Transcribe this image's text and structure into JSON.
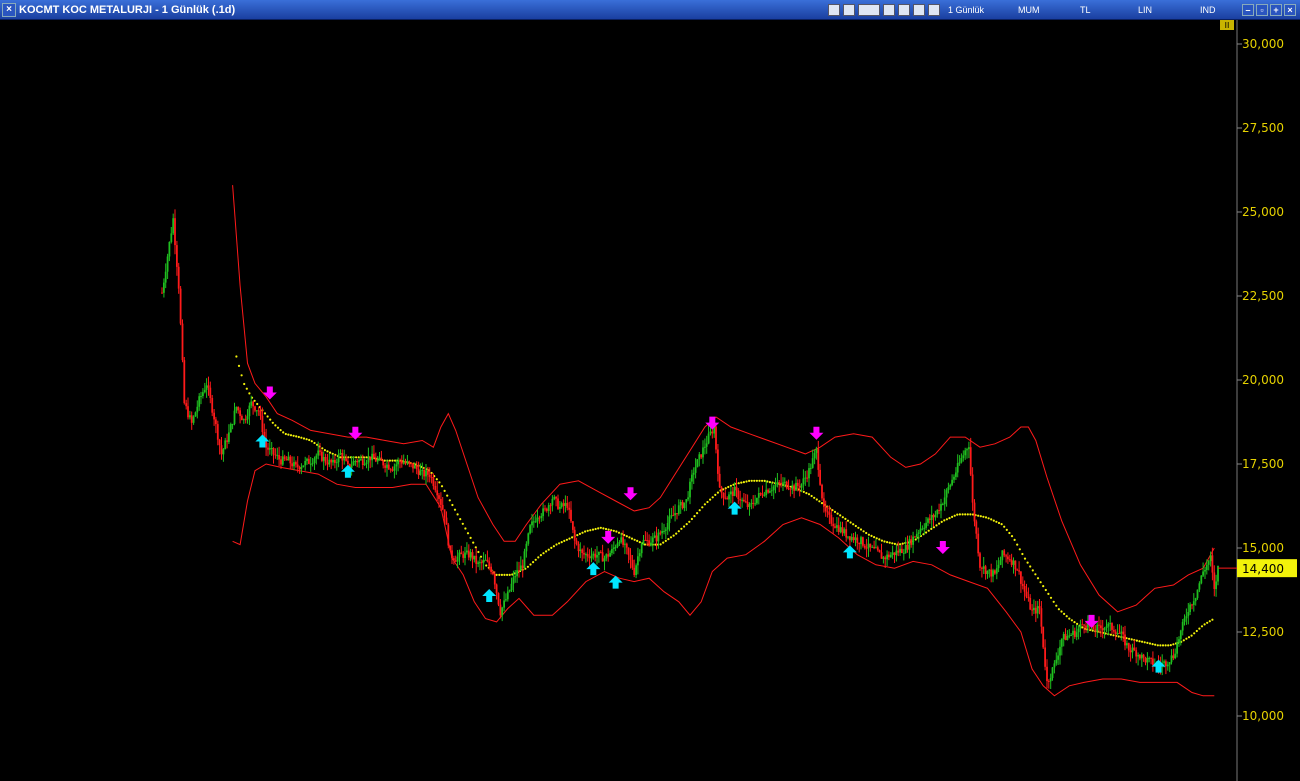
{
  "window": {
    "title": "KOCMT KOC METALURJI - 1 Günlük (.1d)",
    "close_glyph": "×",
    "toolbar_icons": [
      "chart-icon",
      "pdf-icon",
      "forward-icon",
      "compare-icon",
      "pencil-icon",
      "shapes-icon",
      "indicator-icon"
    ],
    "menu": [
      "1 Günlük",
      "MUM",
      "TL",
      "LIN",
      "IND"
    ],
    "window_controls": [
      "minimize",
      "restore",
      "maximize",
      "close"
    ]
  },
  "price_axis_badge": "II",
  "chart_data": {
    "type": "candlestick",
    "title": "",
    "ylim": [
      9000,
      31000
    ],
    "ylabel": "",
    "xlabel": "",
    "y_ticks": [
      "10,000",
      "12,500",
      "15,000",
      "17,500",
      "20,000",
      "22,500",
      "25,000",
      "27,500",
      "30,000"
    ],
    "y_tick_values": [
      10000,
      12500,
      15000,
      17500,
      20000,
      22500,
      25000,
      27500,
      30000
    ],
    "last_price_label": "14,400",
    "last_price": 14400,
    "colors": {
      "up": "#1fbf1f",
      "down": "#ff1a1a",
      "band": "#ff1a1a",
      "midline": "#f2f20a",
      "buy": "#00e5ff",
      "sell": "#ff00ff",
      "axis_text": "#e6d200"
    },
    "price_path": [
      [
        0,
        22600
      ],
      [
        6,
        24800
      ],
      [
        9,
        22800
      ],
      [
        12,
        19300
      ],
      [
        16,
        18700
      ],
      [
        20,
        19400
      ],
      [
        24,
        19900
      ],
      [
        28,
        18900
      ],
      [
        32,
        17800
      ],
      [
        36,
        18400
      ],
      [
        40,
        19200
      ],
      [
        44,
        18800
      ],
      [
        48,
        19300
      ],
      [
        52,
        19100
      ],
      [
        56,
        18000
      ],
      [
        60,
        17800
      ],
      [
        64,
        17600
      ],
      [
        68,
        17600
      ],
      [
        72,
        17400
      ],
      [
        76,
        17500
      ],
      [
        80,
        17600
      ],
      [
        84,
        17800
      ],
      [
        88,
        17600
      ],
      [
        92,
        17500
      ],
      [
        96,
        17800
      ],
      [
        100,
        17400
      ],
      [
        104,
        17600
      ],
      [
        108,
        17600
      ],
      [
        112,
        17700
      ],
      [
        116,
        17600
      ],
      [
        120,
        17500
      ],
      [
        124,
        17400
      ],
      [
        128,
        17600
      ],
      [
        132,
        17500
      ],
      [
        136,
        17400
      ],
      [
        140,
        17200
      ],
      [
        144,
        17200
      ],
      [
        148,
        16700
      ],
      [
        152,
        16000
      ],
      [
        155,
        14800
      ],
      [
        158,
        14700
      ],
      [
        162,
        14800
      ],
      [
        166,
        14800
      ],
      [
        170,
        14500
      ],
      [
        174,
        14600
      ],
      [
        178,
        14300
      ],
      [
        182,
        13100
      ],
      [
        186,
        13600
      ],
      [
        190,
        14200
      ],
      [
        194,
        14500
      ],
      [
        198,
        15600
      ],
      [
        202,
        16000
      ],
      [
        206,
        16100
      ],
      [
        210,
        16500
      ],
      [
        214,
        16200
      ],
      [
        218,
        16300
      ],
      [
        222,
        15200
      ],
      [
        226,
        14800
      ],
      [
        230,
        14800
      ],
      [
        234,
        14800
      ],
      [
        238,
        14700
      ],
      [
        242,
        14900
      ],
      [
        246,
        15300
      ],
      [
        250,
        14900
      ],
      [
        254,
        14300
      ],
      [
        258,
        15200
      ],
      [
        262,
        15200
      ],
      [
        266,
        15300
      ],
      [
        270,
        15600
      ],
      [
        274,
        15900
      ],
      [
        278,
        16200
      ],
      [
        282,
        16400
      ],
      [
        286,
        17300
      ],
      [
        290,
        17800
      ],
      [
        294,
        18300
      ],
      [
        297,
        18600
      ],
      [
        300,
        16700
      ],
      [
        304,
        16500
      ],
      [
        308,
        16700
      ],
      [
        312,
        16400
      ],
      [
        316,
        16200
      ],
      [
        320,
        16500
      ],
      [
        324,
        16700
      ],
      [
        328,
        16800
      ],
      [
        332,
        16900
      ],
      [
        336,
        16900
      ],
      [
        340,
        16800
      ],
      [
        344,
        16900
      ],
      [
        348,
        17300
      ],
      [
        352,
        17900
      ],
      [
        356,
        16100
      ],
      [
        360,
        15800
      ],
      [
        364,
        15600
      ],
      [
        368,
        15400
      ],
      [
        372,
        15300
      ],
      [
        376,
        15200
      ],
      [
        380,
        15000
      ],
      [
        384,
        14900
      ],
      [
        388,
        14700
      ],
      [
        392,
        14800
      ],
      [
        396,
        14900
      ],
      [
        400,
        15000
      ],
      [
        404,
        15300
      ],
      [
        408,
        15600
      ],
      [
        412,
        15800
      ],
      [
        416,
        16000
      ],
      [
        420,
        16400
      ],
      [
        424,
        16900
      ],
      [
        428,
        17400
      ],
      [
        432,
        17900
      ],
      [
        434,
        18100
      ],
      [
        436,
        16300
      ],
      [
        440,
        14500
      ],
      [
        444,
        14300
      ],
      [
        448,
        14200
      ],
      [
        452,
        14800
      ],
      [
        456,
        14700
      ],
      [
        460,
        14400
      ],
      [
        464,
        13700
      ],
      [
        468,
        13100
      ],
      [
        472,
        13200
      ],
      [
        476,
        11000
      ],
      [
        480,
        11500
      ],
      [
        484,
        12300
      ],
      [
        488,
        12400
      ],
      [
        492,
        12500
      ],
      [
        496,
        12800
      ],
      [
        500,
        12600
      ],
      [
        504,
        12600
      ],
      [
        508,
        12700
      ],
      [
        512,
        12600
      ],
      [
        516,
        12400
      ],
      [
        520,
        12000
      ],
      [
        524,
        11900
      ],
      [
        528,
        11700
      ],
      [
        532,
        11600
      ],
      [
        536,
        11500
      ],
      [
        540,
        11600
      ],
      [
        544,
        11800
      ],
      [
        548,
        12500
      ],
      [
        552,
        13200
      ],
      [
        556,
        13600
      ],
      [
        560,
        14300
      ],
      [
        564,
        14700
      ],
      [
        566,
        13700
      ],
      [
        568,
        14400
      ]
    ],
    "upper_band": [
      [
        38,
        25800
      ],
      [
        42,
        22800
      ],
      [
        46,
        20500
      ],
      [
        50,
        19900
      ],
      [
        56,
        19500
      ],
      [
        62,
        19000
      ],
      [
        70,
        18800
      ],
      [
        80,
        18500
      ],
      [
        90,
        18400
      ],
      [
        100,
        18300
      ],
      [
        110,
        18300
      ],
      [
        120,
        18200
      ],
      [
        130,
        18100
      ],
      [
        140,
        18200
      ],
      [
        146,
        18000
      ],
      [
        150,
        18600
      ],
      [
        154,
        19000
      ],
      [
        158,
        18500
      ],
      [
        164,
        17500
      ],
      [
        170,
        16500
      ],
      [
        178,
        15700
      ],
      [
        184,
        15200
      ],
      [
        190,
        15200
      ],
      [
        196,
        15700
      ],
      [
        204,
        16300
      ],
      [
        214,
        16900
      ],
      [
        224,
        17000
      ],
      [
        234,
        16700
      ],
      [
        244,
        16400
      ],
      [
        254,
        16100
      ],
      [
        262,
        16200
      ],
      [
        268,
        16500
      ],
      [
        276,
        17200
      ],
      [
        284,
        17900
      ],
      [
        292,
        18600
      ],
      [
        298,
        18900
      ],
      [
        306,
        18600
      ],
      [
        316,
        18400
      ],
      [
        326,
        18200
      ],
      [
        336,
        18000
      ],
      [
        346,
        17800
      ],
      [
        354,
        18000
      ],
      [
        362,
        18300
      ],
      [
        372,
        18400
      ],
      [
        382,
        18300
      ],
      [
        392,
        17700
      ],
      [
        400,
        17400
      ],
      [
        408,
        17500
      ],
      [
        416,
        17800
      ],
      [
        424,
        18300
      ],
      [
        432,
        18300
      ],
      [
        440,
        18000
      ],
      [
        448,
        18100
      ],
      [
        456,
        18300
      ],
      [
        462,
        18600
      ],
      [
        466,
        18600
      ],
      [
        470,
        18200
      ],
      [
        476,
        17100
      ],
      [
        484,
        15800
      ],
      [
        494,
        14500
      ],
      [
        504,
        13600
      ],
      [
        514,
        13100
      ],
      [
        524,
        13300
      ],
      [
        534,
        13800
      ],
      [
        544,
        13900
      ],
      [
        552,
        14200
      ],
      [
        560,
        14400
      ],
      [
        566,
        15000
      ]
    ],
    "lower_band": [
      [
        38,
        15200
      ],
      [
        42,
        15100
      ],
      [
        46,
        16400
      ],
      [
        50,
        17300
      ],
      [
        56,
        17500
      ],
      [
        64,
        17400
      ],
      [
        74,
        17300
      ],
      [
        84,
        17200
      ],
      [
        94,
        16900
      ],
      [
        104,
        16800
      ],
      [
        114,
        16800
      ],
      [
        124,
        16800
      ],
      [
        134,
        16900
      ],
      [
        142,
        16900
      ],
      [
        150,
        16200
      ],
      [
        156,
        14700
      ],
      [
        162,
        14200
      ],
      [
        168,
        13400
      ],
      [
        174,
        12900
      ],
      [
        180,
        12800
      ],
      [
        186,
        13200
      ],
      [
        192,
        13500
      ],
      [
        200,
        13000
      ],
      [
        210,
        13000
      ],
      [
        218,
        13400
      ],
      [
        228,
        14000
      ],
      [
        238,
        14300
      ],
      [
        246,
        14100
      ],
      [
        254,
        14000
      ],
      [
        262,
        14100
      ],
      [
        270,
        13700
      ],
      [
        278,
        13400
      ],
      [
        284,
        13000
      ],
      [
        290,
        13400
      ],
      [
        296,
        14300
      ],
      [
        304,
        14700
      ],
      [
        314,
        14800
      ],
      [
        324,
        15200
      ],
      [
        334,
        15700
      ],
      [
        344,
        15900
      ],
      [
        354,
        15700
      ],
      [
        364,
        15300
      ],
      [
        374,
        14800
      ],
      [
        384,
        14500
      ],
      [
        394,
        14400
      ],
      [
        404,
        14600
      ],
      [
        414,
        14500
      ],
      [
        424,
        14200
      ],
      [
        434,
        14000
      ],
      [
        444,
        13800
      ],
      [
        454,
        13100
      ],
      [
        462,
        12500
      ],
      [
        468,
        11400
      ],
      [
        474,
        10900
      ],
      [
        480,
        10600
      ],
      [
        488,
        10900
      ],
      [
        496,
        11000
      ],
      [
        506,
        11100
      ],
      [
        516,
        11100
      ],
      [
        526,
        11000
      ],
      [
        536,
        11000
      ],
      [
        546,
        11000
      ],
      [
        554,
        10700
      ],
      [
        560,
        10600
      ],
      [
        566,
        10600
      ]
    ],
    "midline": [
      [
        40,
        20700
      ],
      [
        44,
        19900
      ],
      [
        48,
        19500
      ],
      [
        54,
        19100
      ],
      [
        60,
        18700
      ],
      [
        66,
        18400
      ],
      [
        74,
        18300
      ],
      [
        80,
        18200
      ],
      [
        88,
        17900
      ],
      [
        96,
        17700
      ],
      [
        104,
        17700
      ],
      [
        112,
        17700
      ],
      [
        120,
        17600
      ],
      [
        128,
        17600
      ],
      [
        136,
        17500
      ],
      [
        144,
        17300
      ],
      [
        150,
        16900
      ],
      [
        156,
        16300
      ],
      [
        162,
        15700
      ],
      [
        168,
        15100
      ],
      [
        174,
        14500
      ],
      [
        180,
        14200
      ],
      [
        188,
        14200
      ],
      [
        196,
        14400
      ],
      [
        204,
        14800
      ],
      [
        212,
        15100
      ],
      [
        220,
        15300
      ],
      [
        228,
        15500
      ],
      [
        236,
        15600
      ],
      [
        244,
        15500
      ],
      [
        252,
        15300
      ],
      [
        260,
        15100
      ],
      [
        268,
        15100
      ],
      [
        276,
        15400
      ],
      [
        284,
        15800
      ],
      [
        292,
        16300
      ],
      [
        300,
        16700
      ],
      [
        308,
        16900
      ],
      [
        316,
        17000
      ],
      [
        324,
        17000
      ],
      [
        332,
        16900
      ],
      [
        340,
        16800
      ],
      [
        348,
        16600
      ],
      [
        356,
        16300
      ],
      [
        364,
        16000
      ],
      [
        372,
        15700
      ],
      [
        380,
        15400
      ],
      [
        388,
        15200
      ],
      [
        396,
        15100
      ],
      [
        404,
        15200
      ],
      [
        412,
        15500
      ],
      [
        420,
        15800
      ],
      [
        428,
        16000
      ],
      [
        436,
        16000
      ],
      [
        444,
        15900
      ],
      [
        452,
        15700
      ],
      [
        458,
        15300
      ],
      [
        464,
        14700
      ],
      [
        470,
        14200
      ],
      [
        476,
        13700
      ],
      [
        482,
        13200
      ],
      [
        488,
        12900
      ],
      [
        496,
        12600
      ],
      [
        504,
        12500
      ],
      [
        512,
        12400
      ],
      [
        520,
        12300
      ],
      [
        528,
        12200
      ],
      [
        536,
        12100
      ],
      [
        542,
        12100
      ],
      [
        548,
        12200
      ],
      [
        554,
        12400
      ],
      [
        560,
        12700
      ],
      [
        566,
        12900
      ]
    ],
    "buy_signals": [
      [
        54,
        18200
      ],
      [
        100,
        17300
      ],
      [
        176,
        13600
      ],
      [
        232,
        14400
      ],
      [
        244,
        14000
      ],
      [
        308,
        16200
      ],
      [
        370,
        14900
      ],
      [
        536,
        11500
      ]
    ],
    "sell_signals": [
      [
        58,
        19600
      ],
      [
        104,
        18400
      ],
      [
        252,
        16600
      ],
      [
        240,
        15300
      ],
      [
        296,
        18700
      ],
      [
        352,
        18400
      ],
      [
        420,
        15000
      ],
      [
        500,
        12800
      ]
    ]
  }
}
